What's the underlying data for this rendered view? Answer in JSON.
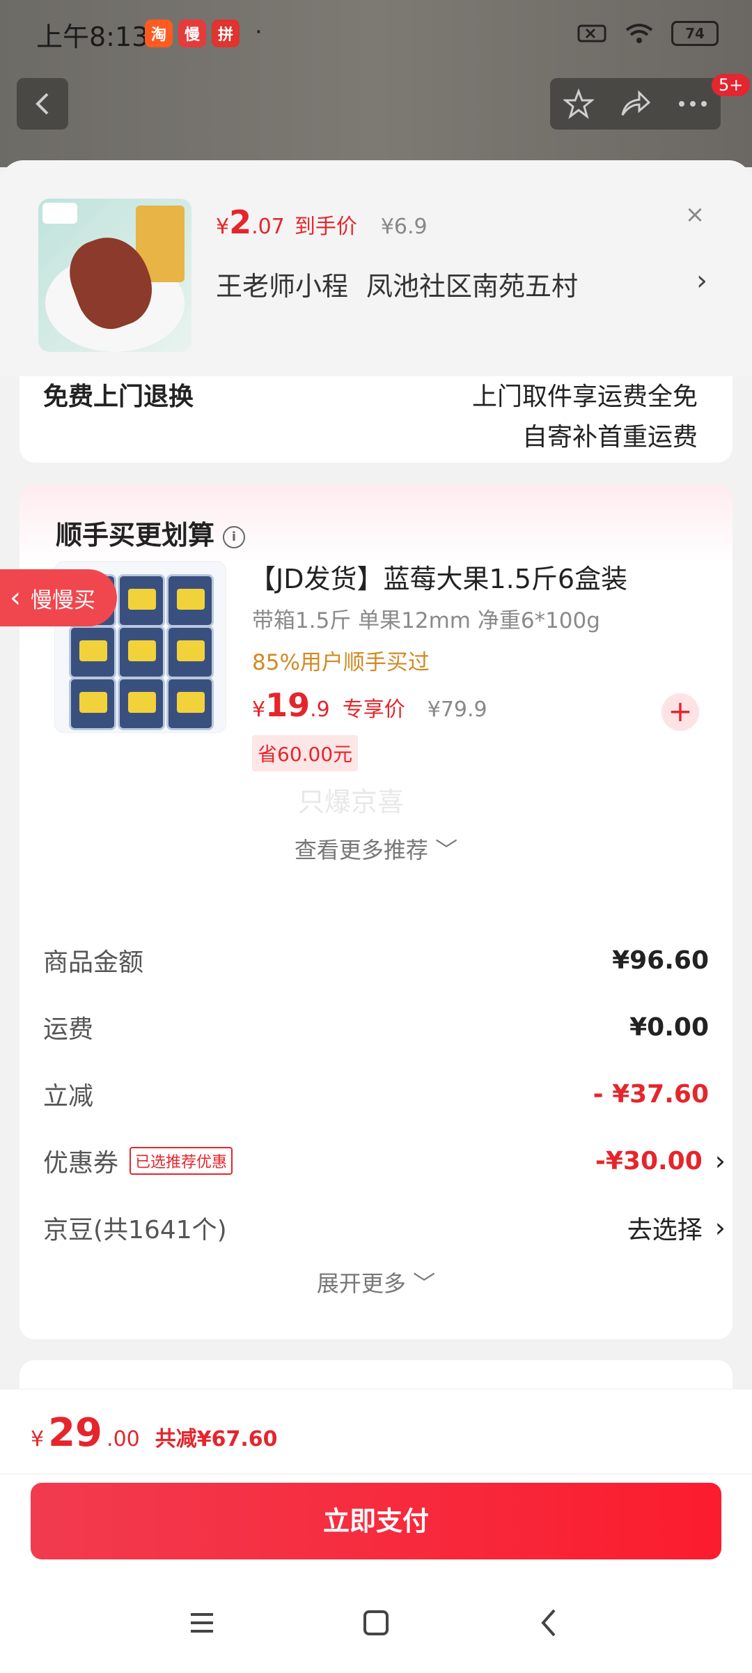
{
  "status_bar": {
    "time": "上午8:13",
    "apps": [
      {
        "name": "taobao",
        "glyph": "淘",
        "color": "#ff5a1f"
      },
      {
        "name": "manmanmai",
        "glyph": "慢",
        "color": "#e63b3b"
      },
      {
        "name": "pdd",
        "glyph": "拼",
        "color": "#e0342e"
      }
    ],
    "dot": "·",
    "battery": "74"
  },
  "top_nav": {
    "badge": "5+"
  },
  "product_header": {
    "currency": "¥",
    "price_int": "2",
    "price_dec": ".07",
    "price_label": "到手价",
    "original_price": "¥6.9",
    "seller": "王老师小程",
    "community": "凤池社区南苑五村",
    "close": "×",
    "chevron": "›"
  },
  "return_card": {
    "left_clipped": "免费上门退换",
    "right_clipped": "上门取件享运费全免",
    "right_line": "自寄补首重运费"
  },
  "recommend": {
    "title": "顺手买更划算",
    "info": "i",
    "product_name": "【JD发货】蓝莓大果1.5斤6盒装",
    "spec": "带箱1.5斤 单果12mm 净重6*100g",
    "users": "85%用户顺手买过",
    "currency": "¥",
    "price_int": "19",
    "price_dec": ".9",
    "price_label": "专享价",
    "original_price": "¥79.9",
    "save": "省60.00元",
    "watermark": "只爆京喜",
    "see_more": "查看更多推荐 ﹀",
    "add": "+"
  },
  "slow_buy": {
    "label": "慢慢买",
    "chevron": "‹"
  },
  "summary": {
    "rows": [
      {
        "label": "商品金额",
        "value": "¥96.60"
      },
      {
        "label": "运费",
        "value": "¥0.00"
      },
      {
        "label": "立减",
        "value": "- ¥37.60"
      },
      {
        "label": "优惠券",
        "tag": "已选推荐优惠",
        "value": "-¥30.00",
        "chevron": "›"
      },
      {
        "label": "京豆(共1641个)",
        "value": "去选择",
        "chevron": "›"
      }
    ],
    "expand": "展开更多 ﹀"
  },
  "bottom": {
    "currency": "¥",
    "total_int": "29",
    "total_dec": ".00",
    "reduce": "共减¥67.60",
    "pay": "立即支付"
  },
  "colors": {
    "accent": "#e4262c",
    "pay_button": "#f6293f"
  }
}
